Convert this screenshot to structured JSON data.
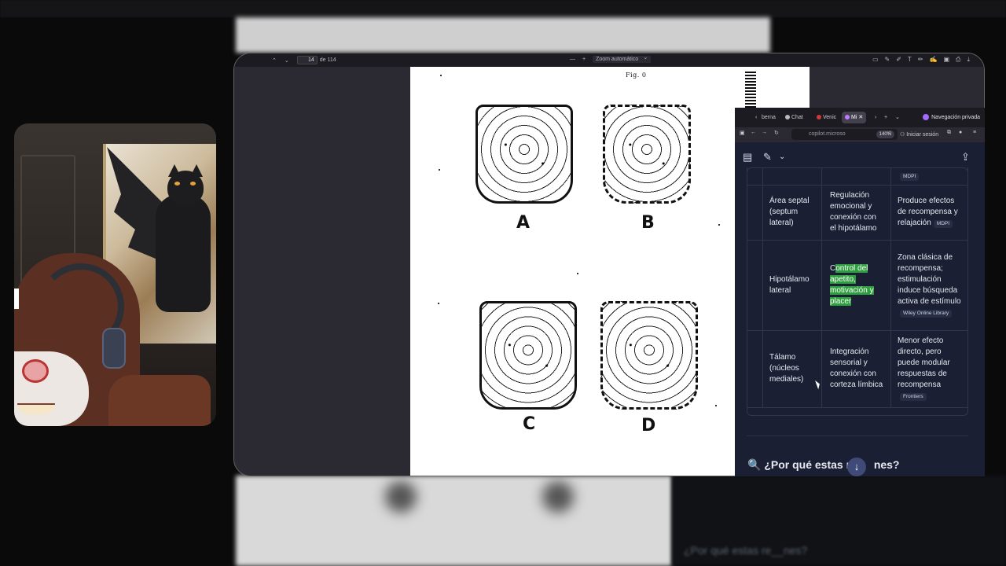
{
  "background": {
    "blurred_question": "¿Por qué estas re__nes?"
  },
  "pdf": {
    "page_number": "14",
    "page_total": "de 114",
    "zoom_label": "Zoom automático",
    "figure_title": "Fig. 0",
    "panels": [
      "A",
      "B",
      "C",
      "D"
    ],
    "tool_icons": [
      "comment-icon",
      "text-edit-icon",
      "highlight-icon",
      "text-icon",
      "draw-icon",
      "signature-icon",
      "image-icon",
      "print-icon",
      "save-icon"
    ]
  },
  "browser": {
    "tabs": [
      {
        "label": "berna",
        "color": "#888888"
      },
      {
        "label": "Chat",
        "color": "#bbbbbb"
      },
      {
        "label": "Venic",
        "color": "#d23a3a"
      },
      {
        "label": "Mi",
        "color": "#c27bff",
        "active": true
      }
    ],
    "private_label": "Navegación privada",
    "url": "copilot.microso",
    "zoom": "140%",
    "signin": "Iniciar sesión"
  },
  "copilot": {
    "rows": [
      {
        "region": "",
        "function": "",
        "effect": "",
        "source": "MDPI"
      },
      {
        "region": "Área septal (septum lateral)",
        "function": "Regulación emocional y conexión con el hipotálamo",
        "effect": "Produce efectos de recompensa y relajación",
        "source": "MDPI"
      },
      {
        "region": "Hipotálamo lateral",
        "function_lead": "C",
        "function_highlight": "ontrol del apetito, motivación y placer",
        "effect": "Zona clásica de recompensa; estimulación induce búsqueda activa de estímulo",
        "source": "Wiley Online Library"
      },
      {
        "region": "Tálamo (núcleos mediales)",
        "function": "Integración sensorial y conexión con corteza límbica",
        "effect": "Menor efecto directo, pero puede modular respuestas de recompensa",
        "source": "Frontiers"
      }
    ],
    "question": "🔍 ¿Por qué estas re",
    "question_tail": "nes?",
    "scroll_icon": "↓"
  },
  "colors": {
    "highlight": "#2e9f3e",
    "accent": "#3f4a78",
    "panel_bg": "#1a1f33"
  }
}
